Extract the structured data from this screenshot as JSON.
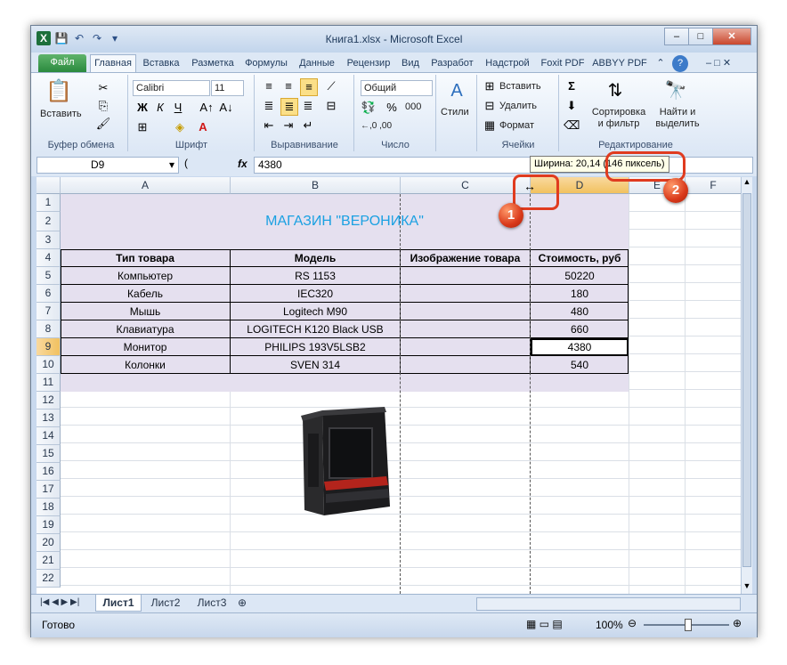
{
  "window": {
    "title": "Книга1.xlsx - Microsoft Excel",
    "controls": {
      "minimize": "–",
      "maximize": "□",
      "close": "✕"
    }
  },
  "quick_access": [
    "X",
    "💾",
    "↶",
    "↷",
    "▾"
  ],
  "tabs": [
    "Файл",
    "Главная",
    "Вставка",
    "Разметка",
    "Формулы",
    "Данные",
    "Рецензир",
    "Вид",
    "Разработ",
    "Надстрой",
    "Foxit PDF",
    "ABBYY PDF"
  ],
  "ribbon": {
    "clipboard": {
      "paste": "Вставить",
      "label": "Буфер обмена"
    },
    "font": {
      "name": "Calibri",
      "size": "11",
      "bold": "Ж",
      "italic": "К",
      "underline": "Ч",
      "color_a": "A",
      "label": "Шрифт"
    },
    "alignment": {
      "label": "Выравнивание"
    },
    "number": {
      "format": "Общий",
      "percent": "%",
      "thousands": "000",
      "inc": "←,0 ,00",
      "label": "Число"
    },
    "styles": {
      "label": "Стили"
    },
    "cells": {
      "insert": "Вставить",
      "delete": "Удалить",
      "format": "Формат",
      "label": "Ячейки"
    },
    "editing": {
      "sum": "Σ",
      "sort": "Сортировка и фильтр",
      "find": "Найти и выделить",
      "label": "Редактирование"
    }
  },
  "formula_bar": {
    "cell_ref": "D9",
    "fx": "fx",
    "value": "4380"
  },
  "tooltip": {
    "width_text": "Ширина: 20,14 ",
    "pixels_text": "(146 пиксель)"
  },
  "columns": [
    "A",
    "B",
    "C",
    "D",
    "E",
    "F"
  ],
  "rows": [
    "1",
    "2",
    "3",
    "4",
    "5",
    "6",
    "7",
    "8",
    "9",
    "10",
    "11",
    "12",
    "13",
    "14",
    "15",
    "16",
    "17",
    "18",
    "19",
    "20",
    "21",
    "22"
  ],
  "sheet": {
    "store_title": "МАГАЗИН \"ВЕРОНИКА\"",
    "headers": [
      "Тип товара",
      "Модель",
      "Изображение товара",
      "Стоимость, руб"
    ],
    "data": [
      [
        "Компьютер",
        "RS 1153",
        "",
        "50220"
      ],
      [
        "Кабель",
        "IEC320",
        "",
        "180"
      ],
      [
        "Мышь",
        "Logitech M90",
        "",
        "480"
      ],
      [
        "Клавиатура",
        "LOGITECH K120 Black USB",
        "",
        "660"
      ],
      [
        "Монитор",
        "PHILIPS 193V5LSB2",
        "",
        "4380"
      ],
      [
        "Колонки",
        "SVEN 314",
        "",
        "540"
      ]
    ]
  },
  "sheet_tabs": [
    "Лист1",
    "Лист2",
    "Лист3"
  ],
  "status": {
    "ready": "Готово",
    "zoom": "100%"
  },
  "callouts": [
    "1",
    "2"
  ],
  "colors": {
    "title_text": "#1ba1e2",
    "table_fill": "#e5e0ef",
    "selection": "#f1c15f"
  }
}
